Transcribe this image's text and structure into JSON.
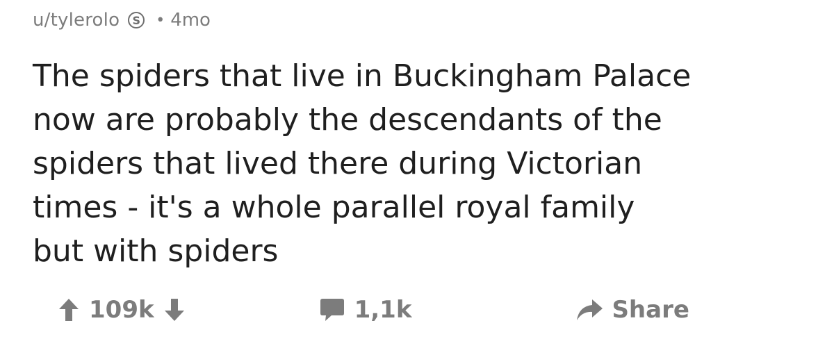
{
  "post": {
    "username": "u/tylerolo",
    "badge_letter": "S",
    "separator": "•",
    "age": "4mo",
    "text": "The spiders that live in Buckingham Palace\nnow are probably the descendants of the\nspiders that lived there during Victorian\ntimes - it's a whole parallel royal family\nbut with spiders"
  },
  "actions": {
    "score": "109k",
    "comments": "1,1k",
    "share_label": "Share"
  },
  "icons": {
    "upvote": "arrow-up-icon",
    "downvote": "arrow-down-icon",
    "comment": "comment-bubble-icon",
    "share": "share-arrow-icon",
    "badge": "s-coin-icon"
  },
  "colors": {
    "text": "#1f1f1f",
    "muted": "#7c7c7c",
    "background": "#ffffff"
  }
}
